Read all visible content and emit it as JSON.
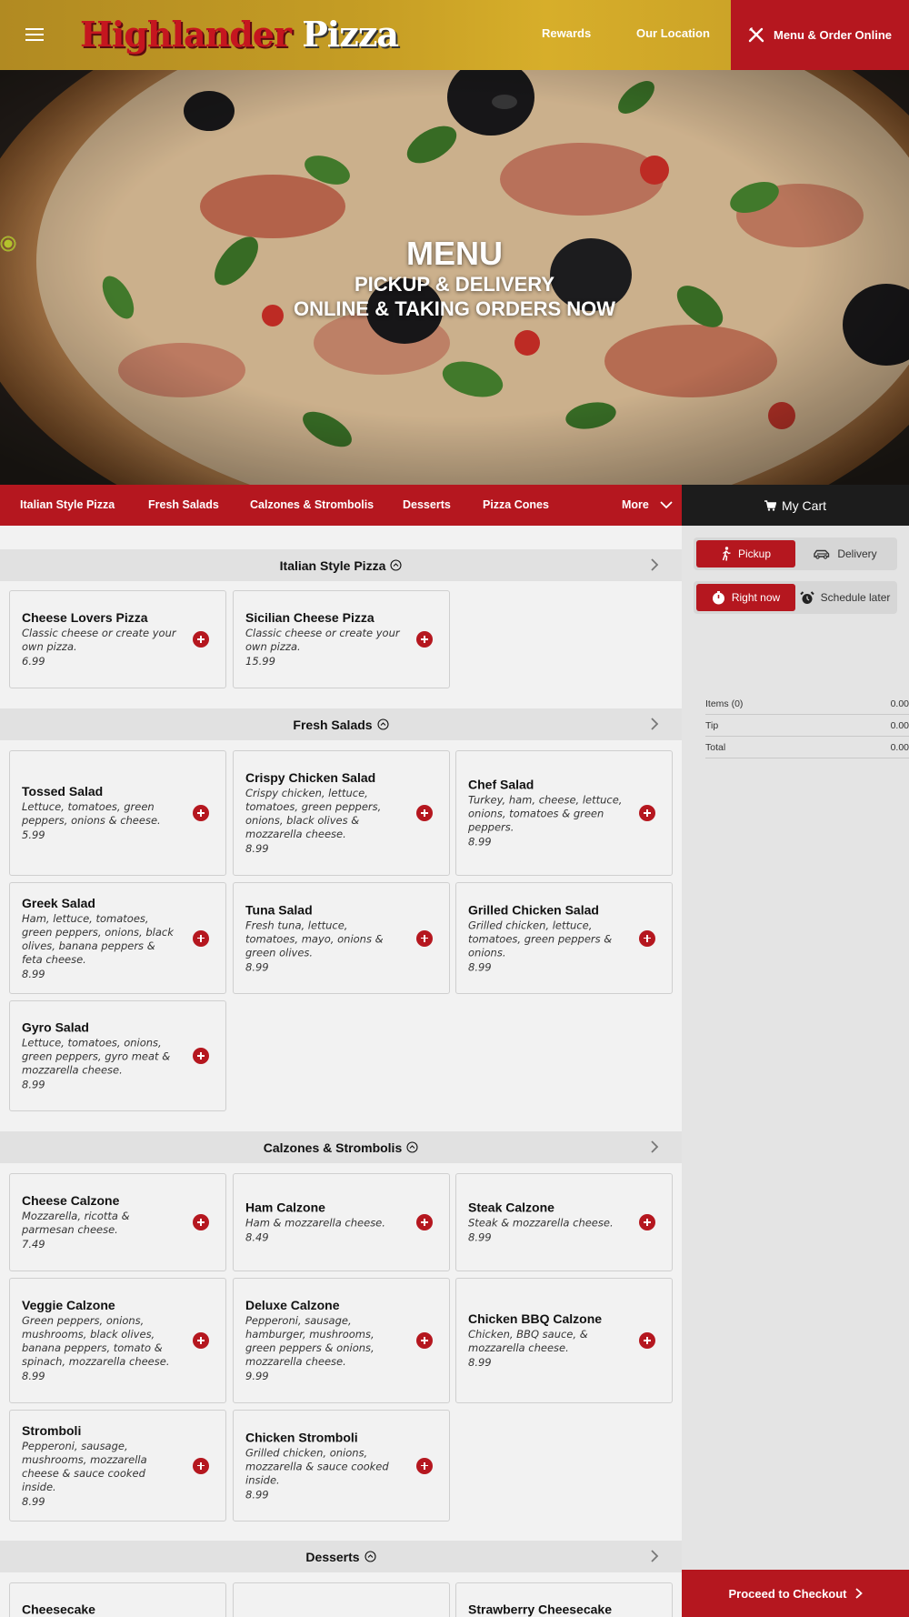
{
  "header": {
    "logo_part1": "Highlander",
    "logo_part2": "Pizza",
    "nav_rewards": "Rewards",
    "nav_location": "Our Location",
    "order_button": "Menu & Order Online"
  },
  "hero": {
    "title": "MENU",
    "line1": "PICKUP & DELIVERY",
    "line2": "ONLINE & TAKING ORDERS NOW"
  },
  "category_bar": {
    "items": [
      "Italian Style Pizza",
      "Fresh Salads",
      "Calzones & Strombolis",
      "Desserts",
      "Pizza Cones"
    ],
    "more": "More"
  },
  "cart": {
    "title": "My Cart",
    "pickup": "Pickup",
    "delivery": "Delivery",
    "right_now": "Right now",
    "schedule": "Schedule later",
    "items_label": "Items (0)",
    "items_value": "0.00",
    "tip_label": "Tip",
    "tip_value": "0.00",
    "total_label": "Total",
    "total_value": "0.00",
    "checkout": "Proceed to Checkout"
  },
  "sections": [
    {
      "title": "Italian Style Pizza",
      "items": [
        {
          "name": "Cheese Lovers Pizza",
          "desc": "Classic cheese or create your own pizza.",
          "price": "6.99"
        },
        {
          "name": "Sicilian Cheese Pizza",
          "desc": "Classic cheese or create your own pizza.",
          "price": "15.99"
        }
      ]
    },
    {
      "title": "Fresh Salads",
      "items": [
        {
          "name": "Tossed Salad",
          "desc": "Lettuce, tomatoes, green peppers, onions & cheese.",
          "price": "5.99"
        },
        {
          "name": "Crispy Chicken Salad",
          "desc": "Crispy chicken, lettuce, tomatoes, green peppers, onions, black olives & mozzarella cheese.",
          "price": "8.99"
        },
        {
          "name": "Chef Salad",
          "desc": "Turkey, ham, cheese, lettuce, onions, tomatoes & green peppers.",
          "price": "8.99"
        },
        {
          "name": "Greek Salad",
          "desc": "Ham, lettuce, tomatoes, green peppers, onions, black olives, banana peppers & feta cheese.",
          "price": "8.99"
        },
        {
          "name": "Tuna Salad",
          "desc": "Fresh tuna, lettuce, tomatoes, mayo, onions & green olives.",
          "price": "8.99"
        },
        {
          "name": "Grilled Chicken Salad",
          "desc": "Grilled chicken, lettuce, tomatoes, green peppers & onions.",
          "price": "8.99"
        },
        {
          "name": "Gyro Salad",
          "desc": "Lettuce, tomatoes, onions, green peppers, gyro meat & mozzarella cheese.",
          "price": "8.99"
        }
      ]
    },
    {
      "title": "Calzones & Strombolis",
      "items": [
        {
          "name": "Cheese Calzone",
          "desc": "Mozzarella, ricotta & parmesan cheese.",
          "price": "7.49"
        },
        {
          "name": "Ham Calzone",
          "desc": "Ham & mozzarella cheese.",
          "price": "8.49"
        },
        {
          "name": "Steak Calzone",
          "desc": "Steak & mozzarella cheese.",
          "price": "8.99"
        },
        {
          "name": "Veggie Calzone",
          "desc": "Green peppers, onions, mushrooms, black olives, banana peppers, tomato & spinach, mozzarella cheese.",
          "price": "8.99"
        },
        {
          "name": "Deluxe Calzone",
          "desc": "Pepperoni, sausage, hamburger, mushrooms, green peppers & onions, mozzarella cheese.",
          "price": "9.99"
        },
        {
          "name": "Chicken BBQ Calzone",
          "desc": "Chicken, BBQ sauce, & mozzarella cheese.",
          "price": "8.99"
        },
        {
          "name": "Stromboli",
          "desc": "Pepperoni, sausage, mushrooms, mozzarella cheese & sauce cooked inside.",
          "price": "8.99"
        },
        {
          "name": "Chicken Stromboli",
          "desc": "Grilled chicken, onions, mozzarella & sauce cooked inside.",
          "price": "8.99"
        }
      ]
    },
    {
      "title": "Desserts",
      "items": [
        {
          "name": "Cheesecake",
          "desc": "",
          "price": ""
        },
        {
          "name": "",
          "desc": "",
          "price": ""
        },
        {
          "name": "Strawberry Cheesecake",
          "desc": "",
          "price": ""
        }
      ]
    }
  ],
  "colors": {
    "brand_red": "#b5171f",
    "header_gold": "#c59d24",
    "cart_bar": "#1c1c1c"
  }
}
